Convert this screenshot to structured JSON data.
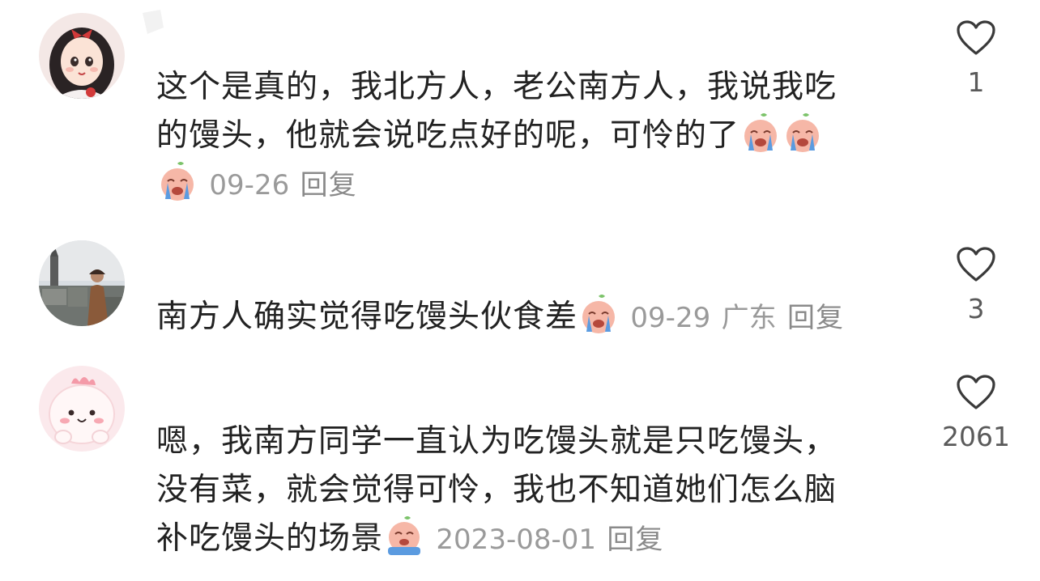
{
  "comments": [
    {
      "text_line1": "这个是真的，我北方人，老公南方人，我说我吃",
      "text_line2": "的馒头，他就会说吃点好的呢，可怜的了",
      "date": "09-26",
      "location": "",
      "reply_label": "回复",
      "likes": "1",
      "avatar_icon": "cartoon-girl-avatar"
    },
    {
      "text_line1": "南方人确实觉得吃馒头伙食差",
      "date": "09-29",
      "location": "广东",
      "reply_label": "回复",
      "likes": "3",
      "avatar_icon": "city-photo-avatar"
    },
    {
      "text_line1": "嗯，我南方同学一直认为吃馒头就是只吃馒头，",
      "text_line2": "没有菜，就会觉得可怜，我也不知道她们怎么脑",
      "text_line3": "补吃馒头的场景",
      "date": "2023-08-01",
      "location": "",
      "reply_label": "回复",
      "likes": "2061",
      "avatar_icon": "pink-blob-avatar"
    }
  ],
  "colors": {
    "text": "#222222",
    "meta": "#9a9a9a",
    "heart_outline": "#3a3a3a",
    "emoji_face": "#f6b7a7",
    "emoji_tear": "#5b9be0"
  },
  "icons": {
    "heart": "heart-outline-icon",
    "crying_emoji": "crying-emoji-icon"
  }
}
